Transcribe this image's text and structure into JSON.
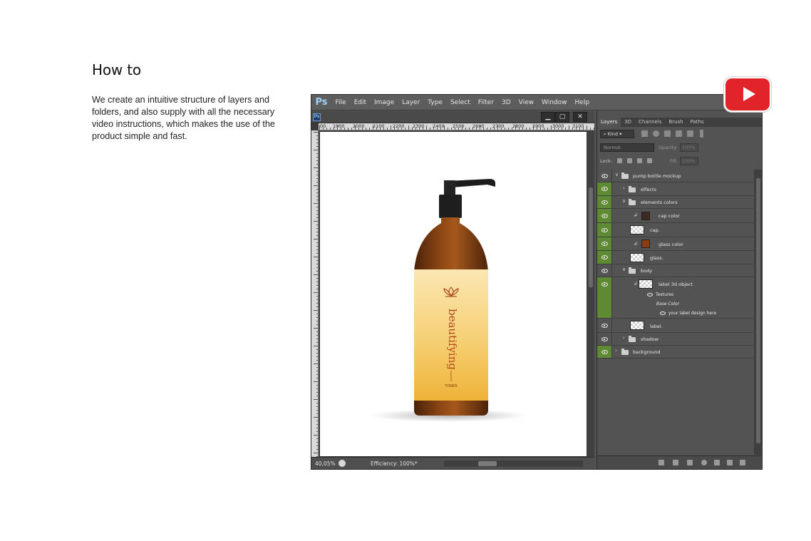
{
  "intro": {
    "title": "How to",
    "body": "We create an intuitive structure of layers and folders, and also supply with all the necessary video instructions, which makes the use of the product simple and fast."
  },
  "photoshop": {
    "logo": "Ps",
    "menu": [
      "File",
      "Edit",
      "Image",
      "Layer",
      "Type",
      "Select",
      "Filter",
      "3D",
      "View",
      "Window",
      "Help"
    ],
    "doc_icon": "Ps",
    "window_buttons": [
      "minimize-icon",
      "restore-icon",
      "close-icon"
    ],
    "ruler_labels": [
      "00",
      "1900",
      "2000",
      "2100",
      "2200",
      "2300",
      "2400",
      "2500",
      "2600",
      "2700",
      "2800",
      "2900",
      "3000",
      "3100"
    ],
    "status": {
      "zoom": "40,05%",
      "efficiency": "Efficiency: 100%*"
    },
    "layers_panel": {
      "tabs": [
        "Layers",
        "3D",
        "Channels",
        "Brush",
        "Paths"
      ],
      "active_tab": "Layers",
      "kind": "Kind",
      "blend_mode": "Normal",
      "opacity_label": "Opacity:",
      "opacity_value": "100%",
      "lock_label": "Lock:",
      "fill_label": "Fill:",
      "fill_value": "100%",
      "layers": [
        {
          "name": "pump bottle mockup",
          "type": "group",
          "expanded": true
        },
        {
          "name": "effects",
          "type": "group",
          "expanded": false
        },
        {
          "name": "elements colors",
          "type": "group",
          "expanded": true
        },
        {
          "name": "cap color",
          "type": "fill",
          "color": "#3a2a22"
        },
        {
          "name": "cap.",
          "type": "smart"
        },
        {
          "name": "glass color",
          "type": "fill",
          "color": "#8a3c12"
        },
        {
          "name": "glass.",
          "type": "smart"
        },
        {
          "name": "body",
          "type": "group",
          "expanded": true
        },
        {
          "name": "label 3d object",
          "type": "3d",
          "sub": [
            "Textures",
            "Base Color",
            "your label design here"
          ]
        },
        {
          "name": "label.",
          "type": "smart"
        },
        {
          "name": "shadow",
          "type": "group",
          "expanded": false
        },
        {
          "name": "background",
          "type": "group",
          "expanded": false
        }
      ]
    }
  },
  "product": {
    "brand": "beautifying",
    "type": "TONER"
  },
  "colors": {
    "youtube": "#e0242a",
    "layer_active": "#5f8a34",
    "ps_bg": "#535353"
  },
  "youtube_button": "play-icon"
}
